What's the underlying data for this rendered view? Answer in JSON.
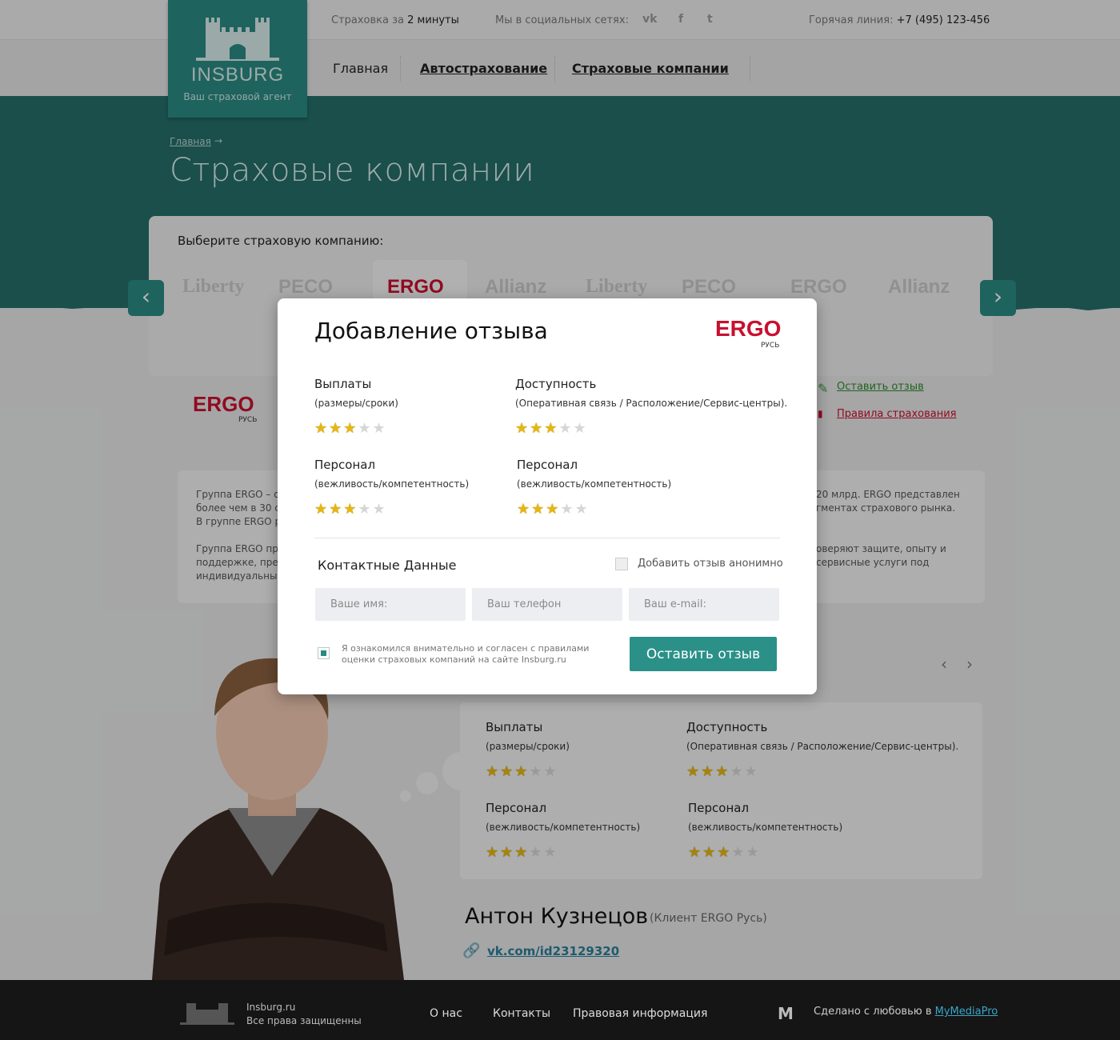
{
  "header": {
    "tagline_prefix": "Страховка за",
    "tagline_bold": "2 минуты",
    "social_label": "Мы в социальных сетях:",
    "hotline_label": "Горячая линия:",
    "hotline_number": "+7 (495) 123-456"
  },
  "logo": {
    "name": "INSBURG",
    "subtitle": "Ваш страховой агент"
  },
  "nav": {
    "home": "Главная",
    "auto": "Автострахование",
    "companies": "Страховые компании"
  },
  "breadcrumb": {
    "home": "Главная"
  },
  "page_title": "Страховые компании",
  "selector": {
    "label": "Выберите страховую компанию:",
    "logos": [
      "Liberty",
      "PECO",
      "ERGO",
      "Allianz",
      "Liberty",
      "PECO",
      "ERGO",
      "Allianz"
    ]
  },
  "company": {
    "logo": "ERGO",
    "logo_sub": "РУСЬ",
    "leave_review": "Оставить отзыв",
    "rules": "Правила страхования",
    "desc_left_1": "Группа ERGO – од",
    "desc_left_2": "более чем в 30 с",
    "desc_left_3": "В группе ERGO ра",
    "desc_left_4": "Группа ERGO пре",
    "desc_left_5": "поддержке, пред",
    "desc_left_6": "индивидуальные",
    "desc_right_1": "20 млрд. ERGO представлен",
    "desc_right_2": "гментах страхового рынка.",
    "desc_right_3": "оверяют защите, опыту и",
    "desc_right_4": "сервисные услуги под"
  },
  "modal": {
    "title": "Добавление отзыва",
    "logo": "ERGO",
    "logo_sub": "РУСЬ",
    "criteria": [
      {
        "title": "Выплаты",
        "sub": "(размеры/сроки)",
        "rating": 3
      },
      {
        "title": "Доступность",
        "sub": "(Оперативная связь / Расположение/Сервис-центры).",
        "rating": 3
      },
      {
        "title": "Персонал",
        "sub": "(вежливость/компетентность)",
        "rating": 3
      },
      {
        "title": "Персонал",
        "sub": "(вежливость/компетентность)",
        "rating": 3
      }
    ],
    "contact_title": "Контактные Данные",
    "anonymous_label": "Добавить отзыв анонимно",
    "name_placeholder": "Ваше имя:",
    "phone_placeholder": "Ваш телефон",
    "email_placeholder": "Ваш e-mail:",
    "agree_text": "Я ознакомился внимательно и согласен с правилами оценки страховых компаний на сайте Insburg.ru",
    "submit": "Оставить отзыв"
  },
  "review": {
    "criteria": [
      {
        "title": "Выплаты",
        "sub": "(размеры/сроки)",
        "rating": 3
      },
      {
        "title": "Доступность",
        "sub": "(Оперативная связь / Расположение/Сервис-центры).",
        "rating": 3
      },
      {
        "title": "Персонал",
        "sub": "(вежливость/компетентность)",
        "rating": 3
      },
      {
        "title": "Персонал",
        "sub": "(вежливость/компетентность)",
        "rating": 3
      }
    ],
    "author": "Антон Кузнецов",
    "author_role": "(Клиент ERGO Русь)",
    "link": "vk.com/id23129320"
  },
  "footer": {
    "site": "Insburg.ru",
    "rights": "Все права защищенны",
    "about": "О нас",
    "contacts": "Контакты",
    "legal": "Правовая информация",
    "made_with": "Сделано с любовью в",
    "studio": "MyMediaPro"
  },
  "colors": {
    "brand": "#2a8a83",
    "star": "#e8b60c",
    "ergo_red": "#c8102e"
  }
}
